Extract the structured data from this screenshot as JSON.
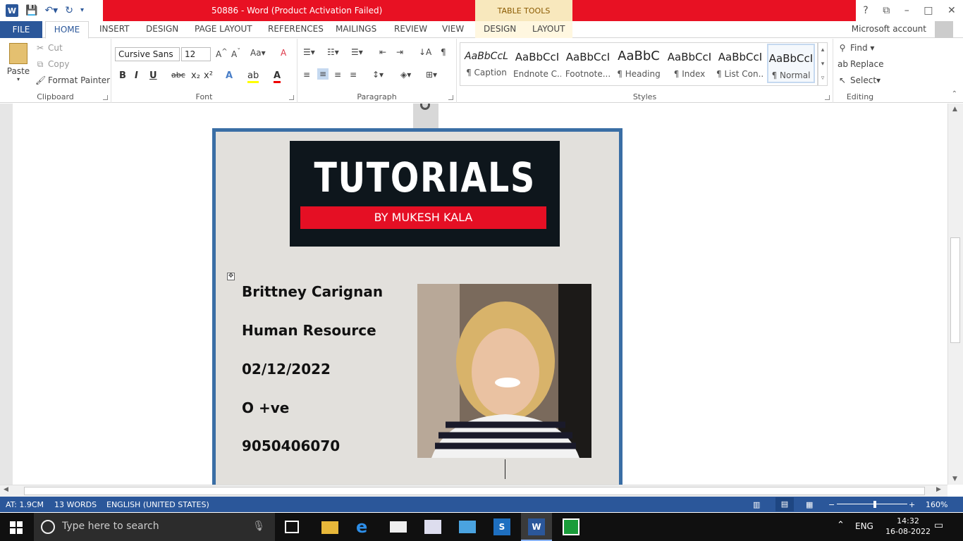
{
  "window": {
    "title": "50886 - Word (Product Activation Failed)",
    "table_tools": "TABLE TOOLS",
    "help": "?",
    "minimize": "–",
    "maximize": "□",
    "close": "✕"
  },
  "tabs": {
    "file": "FILE",
    "home": "HOME",
    "insert": "INSERT",
    "design": "DESIGN",
    "page_layout": "PAGE LAYOUT",
    "references": "REFERENCES",
    "mailings": "MAILINGS",
    "review": "REVIEW",
    "view": "VIEW",
    "tt_design": "DESIGN",
    "tt_layout": "LAYOUT",
    "account": "Microsoft account"
  },
  "clipboard": {
    "paste": "Paste",
    "cut": "Cut",
    "copy": "Copy",
    "format_painter": "Format Painter",
    "label": "Clipboard"
  },
  "font": {
    "name": "Cursive Sans",
    "size": "12",
    "label": "Font"
  },
  "paragraph": {
    "label": "Paragraph"
  },
  "styles": {
    "label": "Styles",
    "items": [
      {
        "sample": "AaBbCcL",
        "name": "¶ Caption"
      },
      {
        "sample": "AaBbCcI",
        "name": "Endnote C..."
      },
      {
        "sample": "AaBbCcI",
        "name": "Footnote..."
      },
      {
        "sample": "AaBbC",
        "name": "¶ Heading"
      },
      {
        "sample": "AaBbCcI",
        "name": "¶ Index"
      },
      {
        "sample": "AaBbCcI",
        "name": "¶ List Con..."
      },
      {
        "sample": "AaBbCcI",
        "name": "¶ Normal"
      }
    ]
  },
  "editing": {
    "find": "Find",
    "replace": "Replace",
    "select": "Select",
    "label": "Editing"
  },
  "card": {
    "banner_title": "TUTORIALS",
    "banner_subtitle": "BY MUKESH KALA",
    "name": "Brittney Carignan",
    "department": "Human Resource",
    "date": "02/12/2022",
    "blood_group": "O +ve",
    "phone": "9050406070"
  },
  "status": {
    "page": "AT: 1.9CM",
    "words": "13 WORDS",
    "language": "ENGLISH (UNITED STATES)",
    "zoom": "160%"
  },
  "taskbar": {
    "search_placeholder": "Type here to search",
    "lang": "ENG",
    "time": "14:32",
    "date": "16-08-2022"
  },
  "colors": {
    "word_blue": "#2b579a",
    "title_red": "#e81123",
    "card_border": "#3a6ea5",
    "banner_red": "#e50f24"
  }
}
